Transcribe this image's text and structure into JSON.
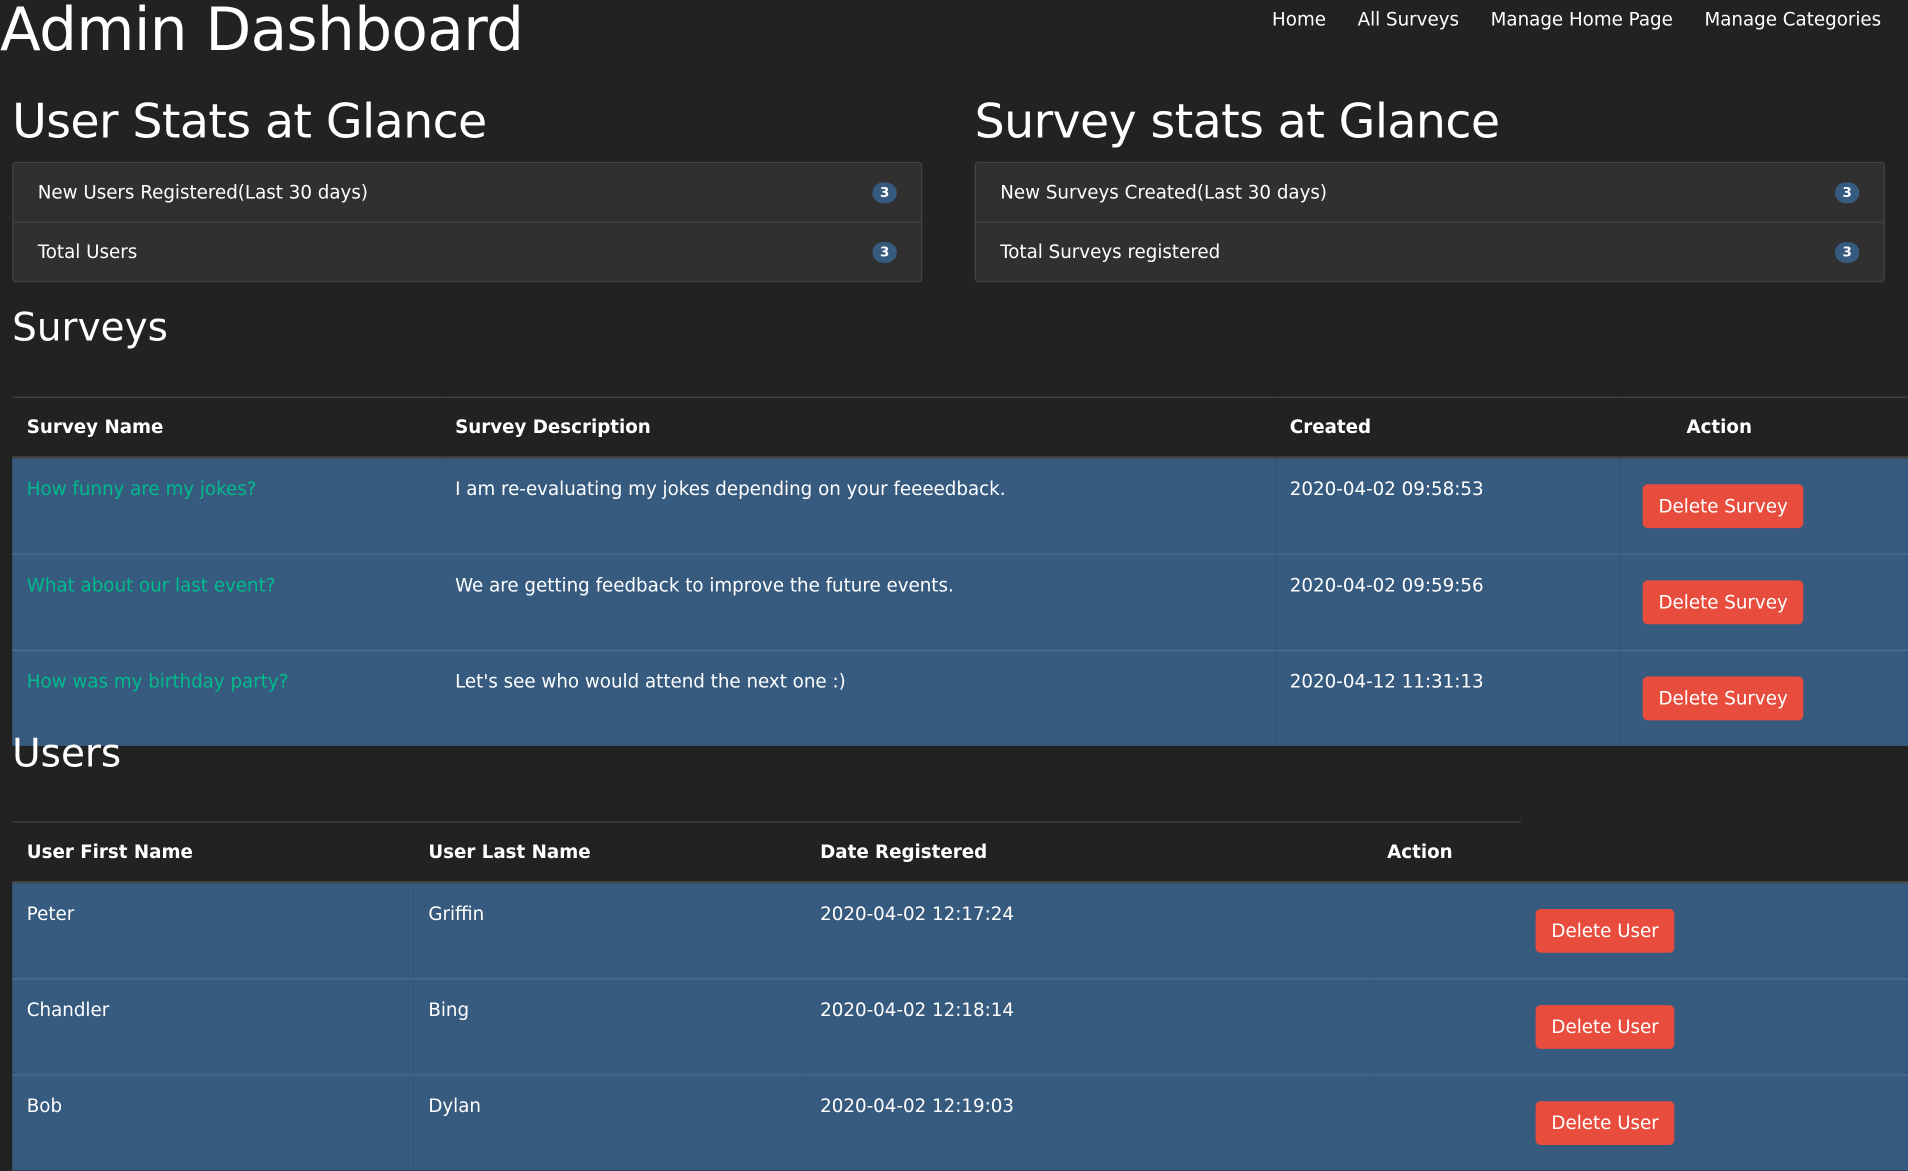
{
  "header": {
    "title": "Admin Dashboard",
    "nav": [
      "Home",
      "All Surveys",
      "Manage Home Page",
      "Manage Categories"
    ]
  },
  "user_stats": {
    "title": "User Stats at Glance",
    "rows": [
      {
        "label": "New Users Registered(Last 30 days)",
        "count": "3"
      },
      {
        "label": "Total Users",
        "count": "3"
      }
    ]
  },
  "survey_stats": {
    "title": "Survey stats at Glance",
    "rows": [
      {
        "label": "New Surveys Created(Last 30 days)",
        "count": "3"
      },
      {
        "label": "Total Surveys registered",
        "count": "3"
      }
    ]
  },
  "surveys": {
    "title": "Surveys",
    "columns": [
      "Survey Name",
      "Survey Description",
      "Created",
      "Action"
    ],
    "rows": [
      {
        "name": "How funny are my jokes?",
        "description": "I am re-evaluating my jokes depending on your feeeedback.",
        "created": "2020-04-02 09:58:53",
        "action": "Delete Survey"
      },
      {
        "name": "What about our last event?",
        "description": "We are getting feedback to improve the future events.",
        "created": "2020-04-02 09:59:56",
        "action": "Delete Survey"
      },
      {
        "name": "How was my birthday party?",
        "description": "Let's see who would attend the next one :)",
        "created": "2020-04-12 11:31:13",
        "action": "Delete Survey"
      }
    ]
  },
  "users": {
    "title": "Users",
    "columns": [
      "User First Name",
      "User Last Name",
      "Date Registered",
      "Action"
    ],
    "rows": [
      {
        "first": "Peter",
        "last": "Griffin",
        "registered": "2020-04-02 12:17:24",
        "action": "Delete User"
      },
      {
        "first": "Chandler",
        "last": "Bing",
        "registered": "2020-04-02 12:18:14",
        "action": "Delete User"
      },
      {
        "first": "Bob",
        "last": "Dylan",
        "registered": "2020-04-02 12:19:03",
        "action": "Delete User"
      }
    ]
  },
  "colors": {
    "background": "#222222",
    "panel": "#303030",
    "row": "#375a7f",
    "link": "#00bc8c",
    "danger": "#e74c3c"
  }
}
